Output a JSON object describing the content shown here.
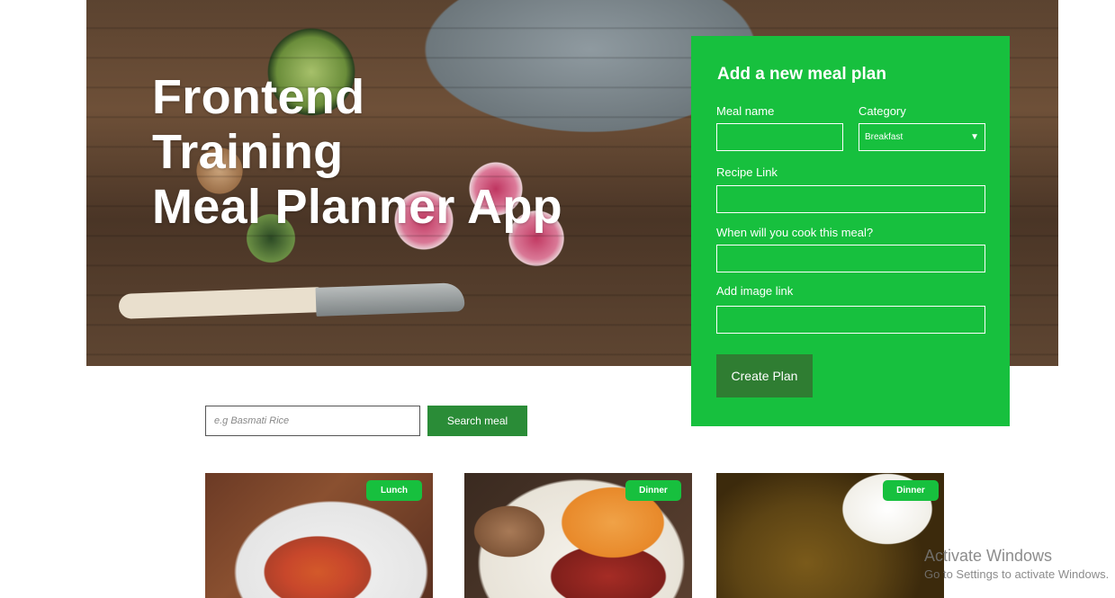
{
  "hero": {
    "title_lines": [
      "Frontend",
      "Training",
      "Meal Planner App"
    ]
  },
  "form": {
    "title": "Add a new meal plan",
    "meal_name_label": "Meal name",
    "category_label": "Category",
    "category_selected": "Breakfast",
    "recipe_link_label": "Recipe Link",
    "cook_time_label": "When will you cook this meal?",
    "image_link_label": "Add image link",
    "submit_label": "Create Plan"
  },
  "search": {
    "placeholder": "e.g Basmati Rice",
    "button_label": "Search meal"
  },
  "cards": [
    {
      "category": "Lunch"
    },
    {
      "category": "Dinner"
    },
    {
      "category": "Dinner"
    }
  ],
  "watermark": {
    "line1": "Activate Windows",
    "line2": "Go to Settings to activate Windows."
  },
  "colors": {
    "accent_green": "#17c03e",
    "dark_green": "#2f7d32"
  }
}
